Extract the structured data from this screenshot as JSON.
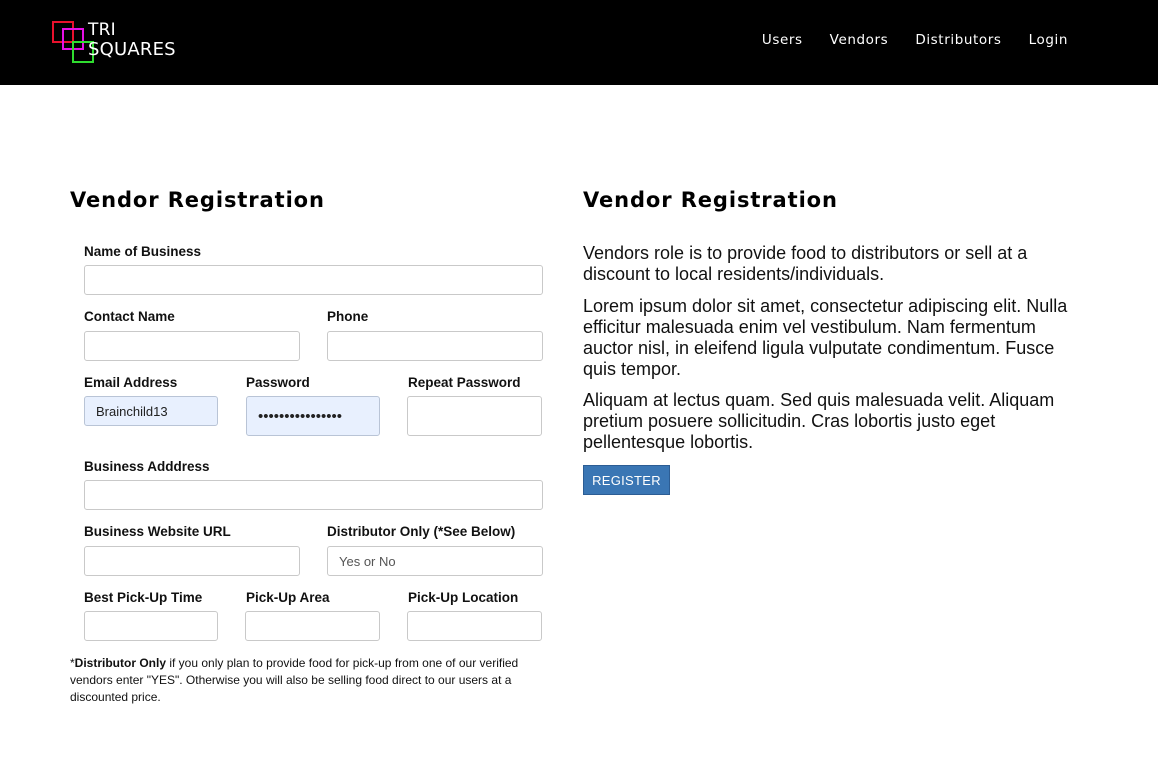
{
  "brand": {
    "line1": "TRI",
    "line2": "SQUARES"
  },
  "nav": {
    "users": "Users",
    "vendors": "Vendors",
    "distributors": "Distributors",
    "login": "Login"
  },
  "form": {
    "title": "Vendor Registration",
    "business_name_label": "Name of Business",
    "contact_name_label": "Contact Name",
    "phone_label": "Phone",
    "email_label": "Email Address",
    "email_value": "Brainchild13",
    "password_label": "Password",
    "password_value": "••••••••••••••••",
    "repeat_password_label": "Repeat Password",
    "business_address_label": "Business Adddress",
    "website_label": "Business Website URL",
    "distributor_label": "Distributor Only (*See Below)",
    "distributor_placeholder": "Yes or No",
    "pickup_time_label": "Best Pick-Up Time",
    "pickup_area_label": "Pick-Up Area",
    "pickup_location_label": "Pick-Up Location",
    "note_prefix": "*",
    "note_bold": "Distributor Only",
    "note_text": " if you only plan to provide food for pick-up from one of our verified vendors enter \"YES\". Otherwise you will also be selling food direct to our users at a discounted price."
  },
  "info": {
    "title": "Vendor Registration",
    "paragraphs": [
      "Vendors role is to provide food to distributors or sell at a discount to local residents/individuals.",
      "Lorem ipsum dolor sit amet, consectetur adipiscing elit. Nulla efficitur malesuada enim vel vestibulum. Nam fermentum auctor nisl, in eleifend ligula vulputate condimentum. Fusce quis tempor.",
      "Aliquam at lectus quam. Sed quis malesuada velit. Aliquam pretium posuere sollicitudin. Cras lobortis justo eget pellentesque lobortis."
    ],
    "register_label": "REGISTER"
  },
  "colors": {
    "navbar": "#000000",
    "button": "#3a76b4",
    "logo_red": "#e8112d",
    "logo_magenta": "#e510e5",
    "logo_green": "#2fdc2f"
  }
}
